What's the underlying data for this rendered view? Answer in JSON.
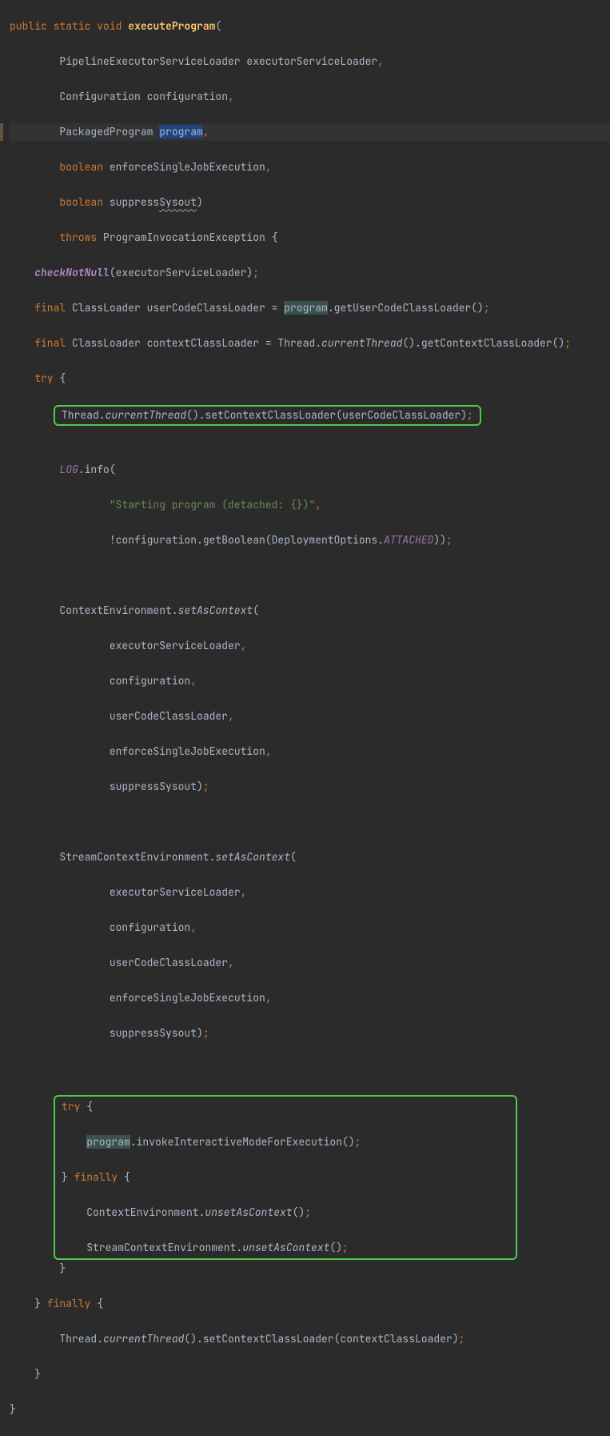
{
  "code": {
    "l01a": "public",
    "l01b": "static",
    "l01c": "void",
    "l01d": "executeProgram",
    "l02a": "PipelineExecutorServiceLoader executorServiceLoader",
    "l03a": "Configuration configuration",
    "l04a": "PackagedProgram ",
    "l04b": "program",
    "l05a": "boolean",
    "l05b": " enforceSingleJobExecution",
    "l06a": "boolean",
    "l06b": " suppress",
    "l06c": "Sysout",
    "l07a": "throws",
    "l07b": " ProgramInvocationException {",
    "l08a": "checkNotNull",
    "l08b": "(executorServiceLoader)",
    "l09a": "final",
    "l09b": " ClassLoader userCodeClassLoader = ",
    "l09c": "program",
    "l09d": ".getUserCodeClassLoader()",
    "l10a": "final",
    "l10b": " ClassLoader contextClassLoader = Thread.",
    "l10c": "currentThread",
    "l10d": "().getContextClassLoader()",
    "l11a": "try",
    "l11b": " {",
    "l12a": "Thread.",
    "l12b": "currentThread",
    "l12c": "().setContextClassLoader(userCodeClassLoader)",
    "l14a": "LOG",
    "l14b": ".info(",
    "l15a": "\"Starting program (detached: {})\"",
    "l16a": "!configuration.getBoolean(DeploymentOptions.",
    "l16b": "ATTACHED",
    "l16c": "))",
    "l18a": "ContextEnvironment.",
    "l18b": "setAsContext",
    "l19a": "executorServiceLoader",
    "l20a": "configuration",
    "l21a": "userCodeClassLoader",
    "l22a": "enforceSingleJobExecution",
    "l23a": "suppressSysout)",
    "l25a": "StreamContextEnvironment.",
    "l25b": "setAsContext",
    "l26a": "executorServiceLoader",
    "l27a": "configuration",
    "l28a": "userCodeClassLoader",
    "l29a": "enforceSingleJobExecution",
    "l30a": "suppressSysout)",
    "l32a": "try",
    "l32b": " {",
    "l33a": "program",
    "l33b": ".invokeInteractiveModeForExecution()",
    "l34a": "} ",
    "l34b": "finally",
    "l34c": " {",
    "l35a": "ContextEnvironment.",
    "l35b": "unsetAsContext",
    "l35c": "()",
    "l36a": "StreamContextEnvironment.",
    "l36b": "unsetAsContext",
    "l36c": "()",
    "l37a": "}",
    "l38a": "} ",
    "l38b": "finally",
    "l38c": " {",
    "l39a": "Thread.",
    "l39b": "currentThread",
    "l39c": "().setContextClassLoader(contextClassLoader)",
    "l40a": "}",
    "l41a": "}"
  }
}
